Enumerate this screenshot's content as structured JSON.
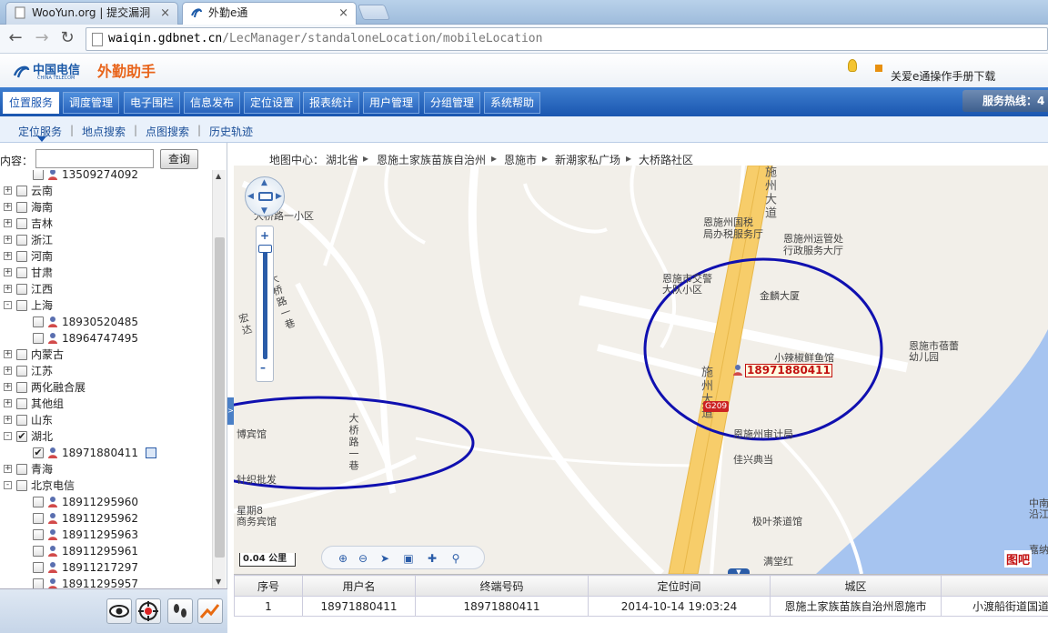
{
  "browser": {
    "tabs": [
      {
        "title": "WooYun.org | 提交漏洞",
        "close": "×"
      },
      {
        "title": "外勤e通",
        "close": "×"
      }
    ],
    "url_domain": "waiqin.gdbnet.cn",
    "url_path": "/LecManager/standaloneLocation/mobileLocation"
  },
  "header": {
    "logo_text": "中国电信",
    "logo_sub": "CHINA TELECOM",
    "app_name": "外勤助手",
    "manual_link": "关爱e通操作手册下载",
    "hotline": "服务热线：4"
  },
  "main_nav": [
    "位置服务",
    "调度管理",
    "电子围栏",
    "信息发布",
    "定位设置",
    "报表统计",
    "用户管理",
    "分组管理",
    "系统帮助"
  ],
  "sub_nav": [
    "定位服务",
    "地点搜索",
    "点图搜索",
    "历史轨迹"
  ],
  "search": {
    "label": "内容：",
    "value": "",
    "button": "查询"
  },
  "tree": [
    {
      "label": "13509274092",
      "level": 1,
      "partial": true
    },
    {
      "label": "云南",
      "level": 0,
      "exp": "+"
    },
    {
      "label": "海南",
      "level": 0,
      "exp": "+"
    },
    {
      "label": "吉林",
      "level": 0,
      "exp": "+"
    },
    {
      "label": "浙江",
      "level": 0,
      "exp": "+"
    },
    {
      "label": "河南",
      "level": 0,
      "exp": "+"
    },
    {
      "label": "甘肃",
      "level": 0,
      "exp": "+"
    },
    {
      "label": "江西",
      "level": 0,
      "exp": "+"
    },
    {
      "label": "上海",
      "level": 0,
      "exp": "-"
    },
    {
      "label": "18930520485",
      "level": 1
    },
    {
      "label": "18964747495",
      "level": 1
    },
    {
      "label": "内蒙古",
      "level": 0,
      "exp": "+"
    },
    {
      "label": "江苏",
      "level": 0,
      "exp": "+"
    },
    {
      "label": "两化融合展",
      "level": 0,
      "exp": "+"
    },
    {
      "label": "其他组",
      "level": 0,
      "exp": "+"
    },
    {
      "label": "山东",
      "level": 0,
      "exp": "+"
    },
    {
      "label": "湖北",
      "level": 0,
      "exp": "-",
      "checked": true
    },
    {
      "label": "18971880411",
      "level": 1,
      "checked": true,
      "cal": true
    },
    {
      "label": "青海",
      "level": 0,
      "exp": "+"
    },
    {
      "label": "北京电信",
      "level": 0,
      "exp": "-"
    },
    {
      "label": "18911295960",
      "level": 1
    },
    {
      "label": "18911295962",
      "level": 1
    },
    {
      "label": "18911295963",
      "level": 1
    },
    {
      "label": "18911295961",
      "level": 1
    },
    {
      "label": "18911217297",
      "level": 1
    },
    {
      "label": "18911295957",
      "level": 1
    }
  ],
  "map": {
    "crumb_prefix": "地图中心：",
    "crumb": [
      "湖北省",
      "恩施土家族苗族自治州",
      "恩施市",
      "新潮家私广场",
      "大桥路社区"
    ],
    "labels": {
      "road_main": "施州大道",
      "road_main2": "施州大道",
      "road_bridge": "大桥路一巷",
      "road_bridge2": "大桥路一巷",
      "road_hong": "宏达",
      "community": "大桥路一小区",
      "tax": "恩施州国税局办税服务厅",
      "tax1": "恩施州国税",
      "tax2": "局办税服务厅",
      "transport1": "恩施州运管处",
      "transport2": "行政服务大厅",
      "police1": "恩施市交警",
      "police2": "大队小区",
      "jinlin": "金麟大厦",
      "fish": "小辣椒鲜鱼馆",
      "kinder1": "恩施市蓓蕾",
      "kinder2": "幼儿园",
      "audit": "恩施州审计局",
      "pawn": "佳兴典当",
      "hotel": "博宾馆",
      "textile": "针织批发",
      "star1": "星期8",
      "star2": "商务宾馆",
      "tea": "极叶茶道馆",
      "manghong": "满堂红",
      "edge1": "中南",
      "edge2": "沿江",
      "edge3": "嘉纳"
    },
    "marker": "18971880411",
    "highway": "G209",
    "scale": "0.04 公里",
    "provider_logo": "图吧"
  },
  "grid": {
    "headers": [
      "序号",
      "用户名",
      "终端号码",
      "定位时间",
      "城区",
      ""
    ],
    "rows": [
      [
        "1",
        "18971880411",
        "18971880411",
        "2014-10-14 19:03:24",
        "恩施土家族苗族自治州恩施市",
        "小渡船街道国道"
      ]
    ]
  },
  "colors": {
    "accent": "#1a56b0",
    "brand_orange": "#e8641b",
    "annotation": "#1010b0",
    "marker": "#c21010"
  },
  "icons": [
    "eye-icon",
    "target-icon",
    "footprints-icon",
    "trend-icon"
  ]
}
